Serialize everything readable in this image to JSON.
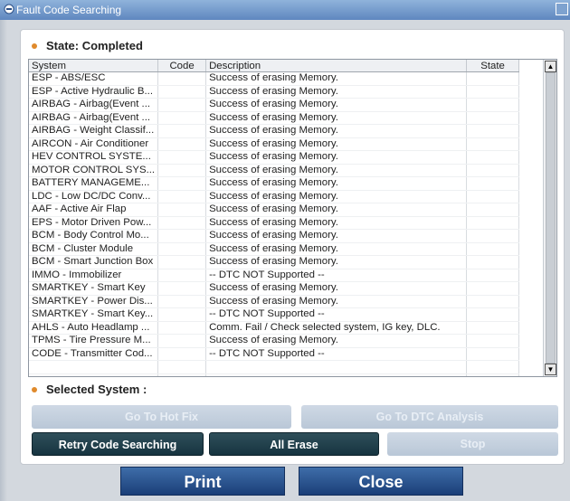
{
  "window": {
    "title": "Fault Code Searching"
  },
  "state": {
    "label": "State: Completed"
  },
  "table": {
    "headers": {
      "system": "System",
      "code": "Code",
      "description": "Description",
      "state": "State"
    },
    "rows": [
      {
        "system": "ESP - ABS/ESC",
        "code": "",
        "description": "Success of erasing Memory."
      },
      {
        "system": "ESP - Active Hydraulic B...",
        "code": "",
        "description": "Success of erasing Memory."
      },
      {
        "system": "AIRBAG - Airbag(Event ...",
        "code": "",
        "description": "Success of erasing Memory."
      },
      {
        "system": "AIRBAG - Airbag(Event ...",
        "code": "",
        "description": "Success of erasing Memory."
      },
      {
        "system": "AIRBAG - Weight Classif...",
        "code": "",
        "description": "Success of erasing Memory."
      },
      {
        "system": "AIRCON - Air Conditioner",
        "code": "",
        "description": "Success of erasing Memory."
      },
      {
        "system": "HEV CONTROL SYSTE...",
        "code": "",
        "description": "Success of erasing Memory."
      },
      {
        "system": "MOTOR CONTROL SYS...",
        "code": "",
        "description": "Success of erasing Memory."
      },
      {
        "system": "BATTERY MANAGEME...",
        "code": "",
        "description": "Success of erasing Memory."
      },
      {
        "system": "LDC - Low DC/DC Conv...",
        "code": "",
        "description": "Success of erasing Memory."
      },
      {
        "system": "AAF - Active Air Flap",
        "code": "",
        "description": "Success of erasing Memory."
      },
      {
        "system": "EPS - Motor Driven Pow...",
        "code": "",
        "description": "Success of erasing Memory."
      },
      {
        "system": "BCM - Body Control Mo...",
        "code": "",
        "description": "Success of erasing Memory."
      },
      {
        "system": "BCM - Cluster Module",
        "code": "",
        "description": "Success of erasing Memory."
      },
      {
        "system": "BCM - Smart Junction Box",
        "code": "",
        "description": "Success of erasing Memory."
      },
      {
        "system": "IMMO - Immobilizer",
        "code": "",
        "description": "-- DTC NOT Supported --"
      },
      {
        "system": "SMARTKEY - Smart Key",
        "code": "",
        "description": "Success of erasing Memory."
      },
      {
        "system": "SMARTKEY - Power Dis...",
        "code": "",
        "description": "Success of erasing Memory."
      },
      {
        "system": "SMARTKEY - Smart Key...",
        "code": "",
        "description": "-- DTC NOT Supported --"
      },
      {
        "system": "AHLS - Auto Headlamp ...",
        "code": "",
        "description": "Comm. Fail / Check selected system, IG key, DLC."
      },
      {
        "system": "TPMS - Tire Pressure M...",
        "code": "",
        "description": "Success of erasing Memory."
      },
      {
        "system": "CODE - Transmitter Cod...",
        "code": "",
        "description": "-- DTC NOT Supported --"
      }
    ]
  },
  "selected": {
    "label": "Selected System :"
  },
  "buttons": {
    "go_to_hot_fix": "Go To Hot Fix",
    "go_to_dtc_analysis": "Go To DTC Analysis",
    "retry_code_searching": "Retry Code Searching",
    "all_erase": "All Erase",
    "stop": "Stop",
    "print": "Print",
    "close": "Close"
  },
  "colors": {
    "title_bar": "#5f87bf",
    "bullet": "#e08a2c",
    "dark_button": "#163440",
    "primary_button": "#1b3f78",
    "disabled_button": "#b9c7d7"
  },
  "icons": {
    "title": "window-app-icon",
    "maximize": "maximize-icon",
    "bullet": "bullet-dot-icon"
  }
}
